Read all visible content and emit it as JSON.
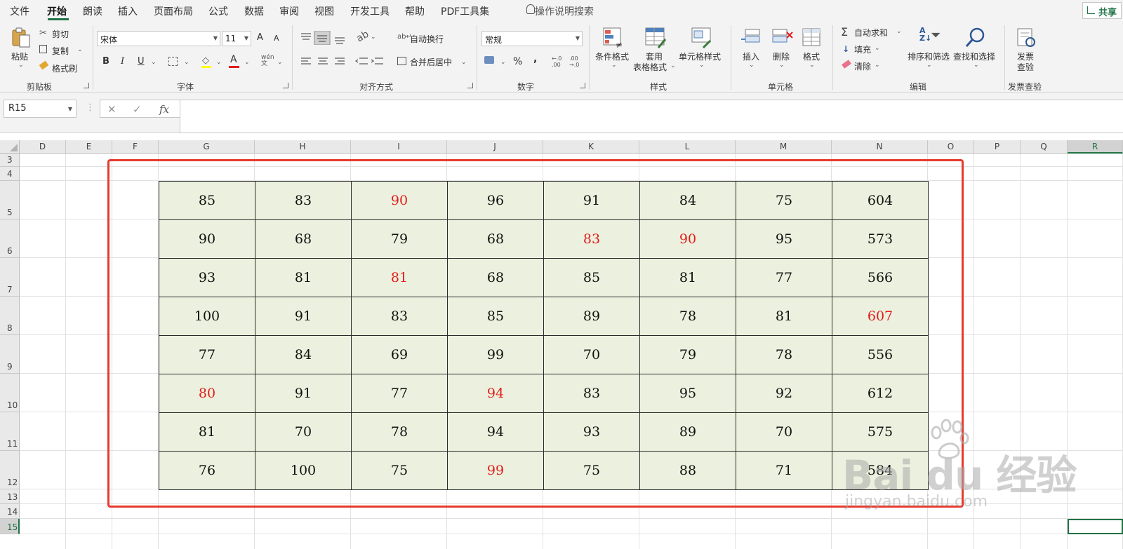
{
  "menu": {
    "items": [
      "文件",
      "开始",
      "朗读",
      "插入",
      "页面布局",
      "公式",
      "数据",
      "审阅",
      "视图",
      "开发工具",
      "帮助",
      "PDF工具集"
    ],
    "active_index": 1,
    "tell_me": "操作说明搜索",
    "share": "共享"
  },
  "ribbon": {
    "clipboard": {
      "paste": "粘贴",
      "cut": "剪切",
      "copy": "复制",
      "format_painter": "格式刷",
      "label": "剪贴板"
    },
    "font": {
      "name": "宋体",
      "size": "11",
      "bold": "B",
      "italic": "I",
      "underline": "U",
      "font_color": "A",
      "phonetic": "wén\n文",
      "grow": "A",
      "shrink": "A",
      "label": "字体"
    },
    "alignment": {
      "wrap": "自动换行",
      "merge": "合并后居中",
      "label": "对齐方式"
    },
    "number": {
      "format": "常规",
      "percent": "%",
      "comma": ",",
      "inc": "←.0\n.00",
      "dec": ".00\n→.0",
      "label": "数字"
    },
    "styles": {
      "conditional": "条件格式",
      "table_line1": "套用",
      "table_line2": "表格格式",
      "cell_styles": "单元格样式",
      "label": "样式"
    },
    "cells": {
      "insert": "插入",
      "delete": "删除",
      "format": "格式",
      "label": "单元格"
    },
    "editing": {
      "autosum": "自动求和",
      "fill": "填充",
      "clear": "清除",
      "sort": "排序和筛选",
      "find": "查找和选择",
      "label": "编辑"
    },
    "invoice": {
      "line1": "发票",
      "line2": "查验",
      "label": "发票查验"
    }
  },
  "formula_bar": {
    "name_box": "R15",
    "cancel": "✕",
    "enter": "✓",
    "fx": "fx",
    "formula": ""
  },
  "sheet": {
    "columns": [
      "D",
      "E",
      "F",
      "G",
      "H",
      "I",
      "J",
      "K",
      "L",
      "M",
      "N",
      "O",
      "P",
      "Q",
      "R"
    ],
    "rows": [
      "3",
      "4",
      "5",
      "6",
      "7",
      "8",
      "9",
      "10",
      "11",
      "12",
      "13",
      "14",
      "15"
    ],
    "selected_column": "R",
    "selected_row": "15",
    "table": [
      [
        {
          "v": "85",
          "red": false
        },
        {
          "v": "83",
          "red": false
        },
        {
          "v": "90",
          "red": true
        },
        {
          "v": "96",
          "red": false
        },
        {
          "v": "91",
          "red": false
        },
        {
          "v": "84",
          "red": false
        },
        {
          "v": "75",
          "red": false
        },
        {
          "v": "604",
          "red": false
        }
      ],
      [
        {
          "v": "90",
          "red": false
        },
        {
          "v": "68",
          "red": false
        },
        {
          "v": "79",
          "red": false
        },
        {
          "v": "68",
          "red": false
        },
        {
          "v": "83",
          "red": true
        },
        {
          "v": "90",
          "red": true
        },
        {
          "v": "95",
          "red": false
        },
        {
          "v": "573",
          "red": false
        }
      ],
      [
        {
          "v": "93",
          "red": false
        },
        {
          "v": "81",
          "red": false
        },
        {
          "v": "81",
          "red": true
        },
        {
          "v": "68",
          "red": false
        },
        {
          "v": "85",
          "red": false
        },
        {
          "v": "81",
          "red": false
        },
        {
          "v": "77",
          "red": false
        },
        {
          "v": "566",
          "red": false
        }
      ],
      [
        {
          "v": "100",
          "red": false
        },
        {
          "v": "91",
          "red": false
        },
        {
          "v": "83",
          "red": false
        },
        {
          "v": "85",
          "red": false
        },
        {
          "v": "89",
          "red": false
        },
        {
          "v": "78",
          "red": false
        },
        {
          "v": "81",
          "red": false
        },
        {
          "v": "607",
          "red": true
        }
      ],
      [
        {
          "v": "77",
          "red": false
        },
        {
          "v": "84",
          "red": false
        },
        {
          "v": "69",
          "red": false
        },
        {
          "v": "99",
          "red": false
        },
        {
          "v": "70",
          "red": false
        },
        {
          "v": "79",
          "red": false
        },
        {
          "v": "78",
          "red": false
        },
        {
          "v": "556",
          "red": false
        }
      ],
      [
        {
          "v": "80",
          "red": true
        },
        {
          "v": "91",
          "red": false
        },
        {
          "v": "77",
          "red": false
        },
        {
          "v": "94",
          "red": true
        },
        {
          "v": "83",
          "red": false
        },
        {
          "v": "95",
          "red": false
        },
        {
          "v": "92",
          "red": false
        },
        {
          "v": "612",
          "red": false
        }
      ],
      [
        {
          "v": "81",
          "red": false
        },
        {
          "v": "70",
          "red": false
        },
        {
          "v": "78",
          "red": false
        },
        {
          "v": "94",
          "red": false
        },
        {
          "v": "93",
          "red": false
        },
        {
          "v": "89",
          "red": false
        },
        {
          "v": "70",
          "red": false
        },
        {
          "v": "575",
          "red": false
        }
      ],
      [
        {
          "v": "76",
          "red": false
        },
        {
          "v": "100",
          "red": false
        },
        {
          "v": "75",
          "red": false
        },
        {
          "v": "99",
          "red": true
        },
        {
          "v": "75",
          "red": false
        },
        {
          "v": "88",
          "red": false
        },
        {
          "v": "71",
          "red": false
        },
        {
          "v": "584",
          "red": false
        }
      ]
    ],
    "cell_fill": "#ebf1de",
    "highlight_color": "#e31b1b",
    "frame_color": "#e63a2e"
  },
  "watermark": {
    "main": "Bai du 经验",
    "sub": "jingyan.baidu.com"
  }
}
